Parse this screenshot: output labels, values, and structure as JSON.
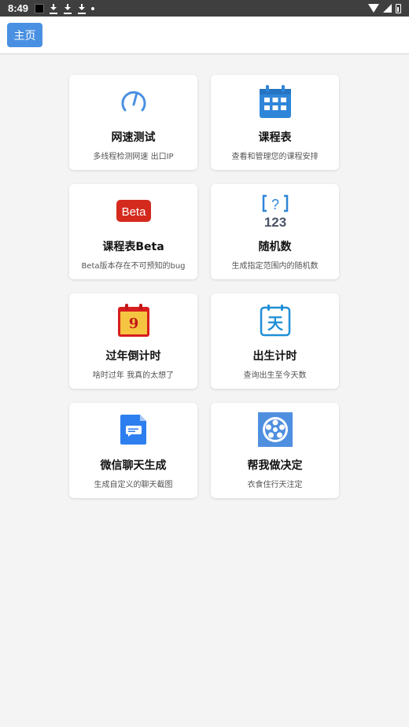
{
  "status_bar": {
    "time": "8:49"
  },
  "appbar": {
    "home_label": "主页"
  },
  "cards": [
    {
      "title": "网速测试",
      "subtitle": "多线程检测网速 出口IP",
      "icon": "speedometer-icon"
    },
    {
      "title": "课程表",
      "subtitle": "查看和管理您的课程安排",
      "icon": "calendar-icon"
    },
    {
      "title": "课程表Beta",
      "subtitle": "Beta版本存在不可预知的bug",
      "icon": "beta-badge-icon",
      "icon_text": "Beta"
    },
    {
      "title": "随机数",
      "subtitle": "生成指定范围内的随机数",
      "icon": "random-number-icon",
      "icon_text_top": "?",
      "icon_text_bottom": "123"
    },
    {
      "title": "过年倒计时",
      "subtitle": "啥时过年 我真的太想了",
      "icon": "new-year-calendar-icon",
      "icon_text": "9"
    },
    {
      "title": "出生计时",
      "subtitle": "查询出生至今天数",
      "icon": "birth-calendar-icon",
      "icon_text": "天"
    },
    {
      "title": "微信聊天生成",
      "subtitle": "生成自定义的聊天截图",
      "icon": "chat-document-icon"
    },
    {
      "title": "帮我做决定",
      "subtitle": "衣食住行天注定",
      "icon": "decision-wheel-icon"
    }
  ]
}
